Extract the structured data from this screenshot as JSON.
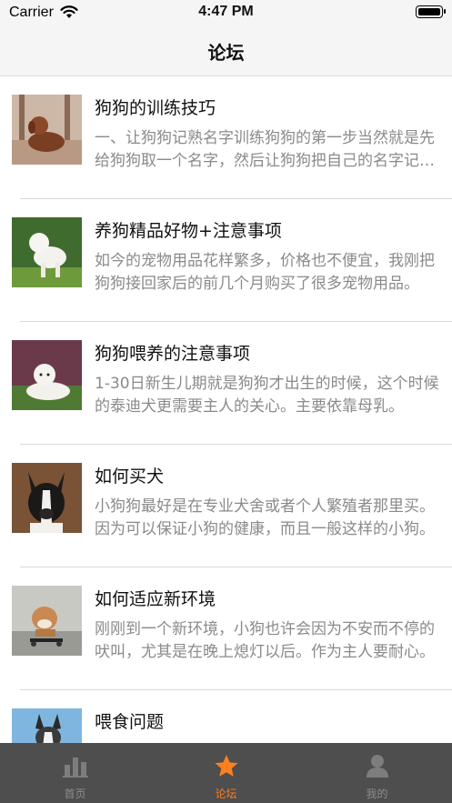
{
  "status_bar": {
    "carrier": "Carrier",
    "time": "4:47 PM"
  },
  "nav": {
    "title": "论坛"
  },
  "posts": [
    {
      "title": "狗狗的训练技巧",
      "desc": "一、让狗狗记熟名字训练狗狗的第一步当然就是先给狗狗取一个名字，然后让狗狗把自己的名字记熟。"
    },
    {
      "title": "养狗精品好物+注意事项",
      "desc": "如今的宠物用品花样繁多，价格也不便宜，我刚把狗狗接回家后的前几个月购买了很多宠物用品。"
    },
    {
      "title": "狗狗喂养的注意事项",
      "desc": "1-30日新生儿期就是狗狗才出生的时候，这个时候的泰迪犬更需要主人的关心。主要依靠母乳。"
    },
    {
      "title": "如何买犬",
      "desc": "小狗狗最好是在专业犬舍或者个人繁殖者那里买。因为可以保证小狗的健康，而且一般这样的小狗。"
    },
    {
      "title": "如何适应新环境",
      "desc": "刚刚到一个新环境，小狗也许会因为不安而不停的吠叫，尤其是在晚上熄灯以后。作为主人要耐心。"
    },
    {
      "title": "喂食问题",
      "desc": ""
    }
  ],
  "tabs": [
    {
      "label": "首页",
      "icon": "bar-chart-icon"
    },
    {
      "label": "论坛",
      "icon": "star-icon"
    },
    {
      "label": "我的",
      "icon": "person-icon"
    }
  ],
  "colors": {
    "accent": "#ff7f1f",
    "tab_bg": "#4e4e4e",
    "inactive": "#8c8c8c"
  }
}
